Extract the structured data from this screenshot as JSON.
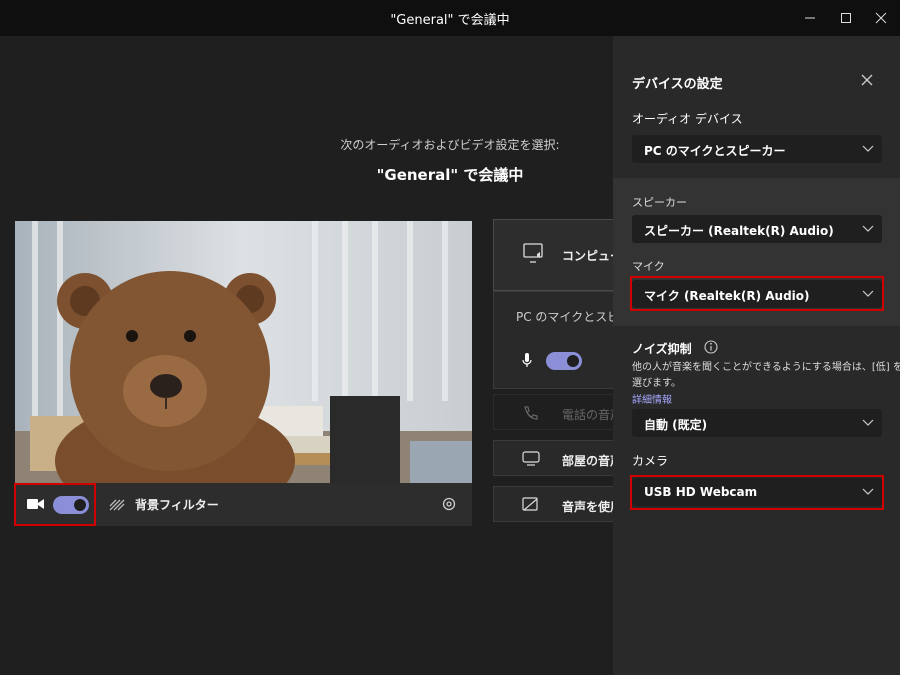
{
  "window": {
    "title": "\"General\" で会議中"
  },
  "prejoin": {
    "subtitle": "次のオーディオおよびビデオ設定を選択:",
    "meeting_name": "\"General\" で会議中",
    "background_filter_label": "背景フィルター",
    "camera_toggle_on": true,
    "mic_toggle_on": true
  },
  "audio_options": {
    "computer_audio_label": "コンピュータ",
    "computer_audio_device": "PC のマイクとスピーカー",
    "phone_audio_label": "電話の音声",
    "room_audio_label": "部屋の音声",
    "no_audio_label": "音声を使用"
  },
  "device_panel": {
    "title": "デバイスの設定",
    "audio_device_label": "オーディオ デバイス",
    "audio_device_value": "PC のマイクとスピーカー",
    "speaker_label": "スピーカー",
    "speaker_value": "スピーカー (Realtek(R) Audio)",
    "mic_label": "マイク",
    "mic_value": "マイク (Realtek(R) Audio)",
    "noise_label": "ノイズ抑制",
    "noise_desc_1": "他の人が音楽を聞くことができるようにする場合は、[低] を",
    "noise_desc_2": "選びます。",
    "noise_link": "詳細情報",
    "noise_value": "自動 (既定)",
    "camera_label": "カメラ",
    "camera_value": "USB HD Webcam"
  },
  "colors": {
    "accent": "#8b8fd8",
    "highlight": "#d00000",
    "panel_bg": "#292929",
    "main_bg": "#1f1f1f"
  }
}
